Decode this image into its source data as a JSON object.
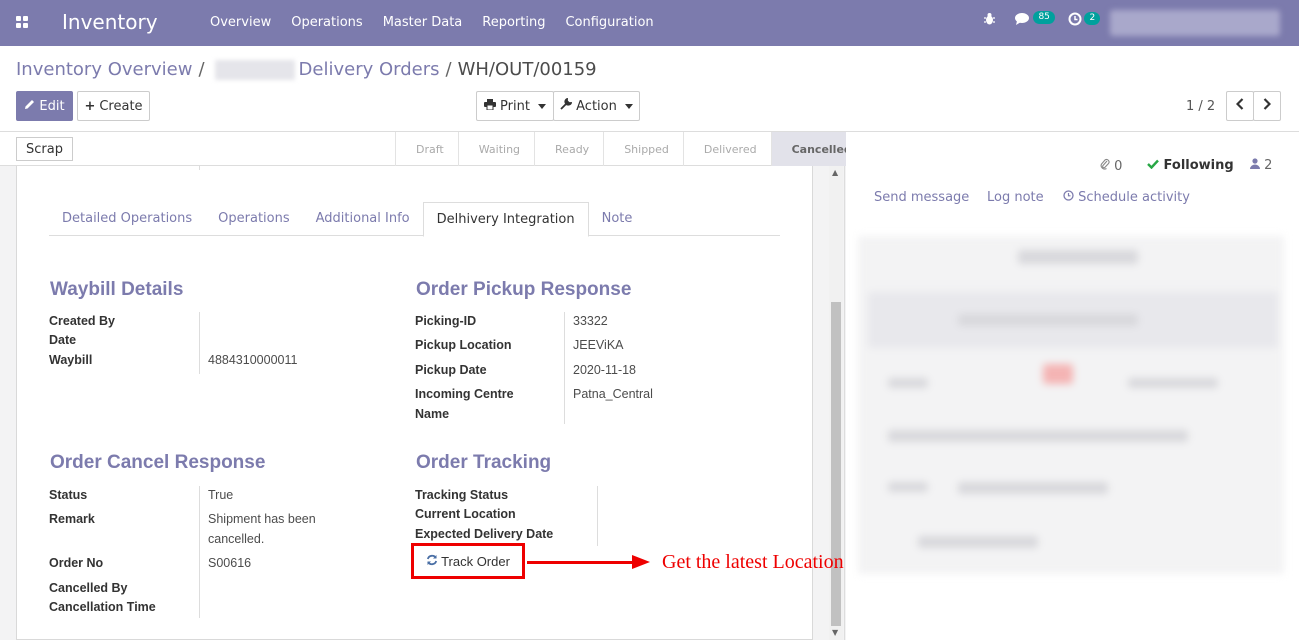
{
  "navbar": {
    "brand": "Inventory",
    "menu": [
      "Overview",
      "Operations",
      "Master Data",
      "Reporting",
      "Configuration"
    ],
    "messages_count": "85",
    "activities_count": "2"
  },
  "breadcrumb": {
    "root": "Inventory Overview",
    "sep1": "/",
    "parent": "Delivery Orders",
    "sep2": "/",
    "current": "WH/OUT/00159"
  },
  "buttons": {
    "edit": "Edit",
    "create": "Create",
    "print": "Print",
    "action": "Action",
    "scrap": "Scrap",
    "track_order": "Track Order"
  },
  "pager": {
    "value": "1 / 2"
  },
  "stages": [
    "Draft",
    "Waiting",
    "Ready",
    "Shipped",
    "Delivered",
    "Cancelled"
  ],
  "active_stage": "Cancelled",
  "tabs": [
    "Detailed Operations",
    "Operations",
    "Additional Info",
    "Delhivery Integration",
    "Note"
  ],
  "active_tab": "Delhivery Integration",
  "waybill": {
    "title": "Waybill Details",
    "created_by_label": "Created By",
    "date_label": "Date",
    "waybill_label": "Waybill",
    "waybill_value": "4884310000011"
  },
  "pickup": {
    "title": "Order Pickup Response",
    "picking_id_label": "Picking-ID",
    "picking_id_value": "33322",
    "location_label": "Pickup Location",
    "location_value": "JEEViKA",
    "date_label": "Pickup Date",
    "date_value": "2020-11-18",
    "centre_label_1": "Incoming Centre",
    "centre_label_2": "Name",
    "centre_value": "Patna_Central"
  },
  "cancel": {
    "title": "Order Cancel Response",
    "status_label": "Status",
    "status_value": "True",
    "remark_label": "Remark",
    "remark_value_1": "Shipment has been",
    "remark_value_2": "cancelled.",
    "order_no_label": "Order No",
    "order_no_value": "S00616",
    "cancelled_by_label": "Cancelled By",
    "cancellation_time_label": "Cancellation Time"
  },
  "tracking": {
    "title": "Order Tracking",
    "status_label": "Tracking Status",
    "location_label": "Current Location",
    "edd_label": "Expected Delivery Date"
  },
  "annotation": "Get the latest Location of Order",
  "chatter": {
    "attachments": "0",
    "following": "Following",
    "followers": "2",
    "send_message": "Send message",
    "log_note": "Log note",
    "schedule_activity": "Schedule activity"
  },
  "colors": {
    "brand": "#7c7bad",
    "annotation": "#e00000",
    "badge": "#00a09d"
  }
}
